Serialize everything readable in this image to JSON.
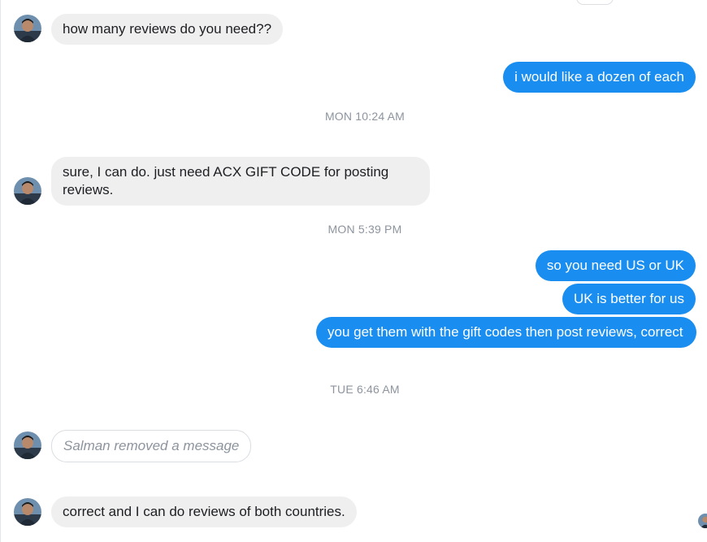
{
  "conversation": {
    "contact_name": "Salman",
    "colors": {
      "incoming_bubble": "#f0eff0",
      "outgoing_bubble": "#1a8ef0",
      "timestamp": "#8d949e"
    },
    "messages": [
      {
        "side": "incoming",
        "text": "how many reviews do you need??"
      },
      {
        "side": "outgoing",
        "text": "i would like a dozen of each"
      },
      {
        "side": "timestamp",
        "text": "MON 10:24 AM"
      },
      {
        "side": "incoming",
        "text": "sure, I can do. just need ACX GIFT CODE for posting reviews."
      },
      {
        "side": "timestamp",
        "text": "MON 5:39 PM"
      },
      {
        "side": "outgoing",
        "text": "so you need US or UK"
      },
      {
        "side": "outgoing",
        "text": "UK is better for us"
      },
      {
        "side": "outgoing",
        "text": "you get them with the gift codes then post reviews, correct"
      },
      {
        "side": "timestamp",
        "text": "TUE 6:46 AM"
      },
      {
        "side": "removed",
        "text": "Salman removed a message"
      },
      {
        "side": "incoming",
        "text": "correct and I can do reviews of both countries."
      }
    ]
  }
}
